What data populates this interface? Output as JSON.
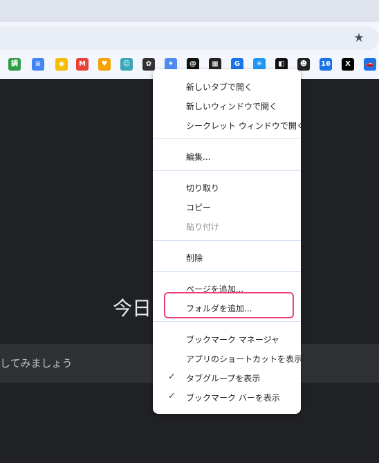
{
  "background": {
    "today_text": "今日",
    "search_text": "してみましょう"
  },
  "toolbar": {
    "star_icon": "bookmark-star-icon"
  },
  "bookmarks": {
    "icons": [
      {
        "name": "chosei-icon",
        "glyph": "調",
        "color": "#2e9e44"
      },
      {
        "name": "google-docs-icon",
        "glyph": "≡",
        "color": "#4285f4"
      },
      {
        "name": "google-keep-icon",
        "glyph": "◉",
        "color": "#f9bb00"
      },
      {
        "name": "gmail-icon",
        "glyph": "M",
        "color": "#ea4335"
      },
      {
        "name": "heart-app-icon",
        "glyph": "♥",
        "color": "#f4a300"
      },
      {
        "name": "avatar-icon",
        "glyph": "☺",
        "color": "#3aa6b9"
      },
      {
        "name": "chatgpt-icon",
        "glyph": "✿",
        "color": "#333333"
      },
      {
        "name": "gemini-icon",
        "glyph": "✦",
        "color": "#4f8bf5"
      },
      {
        "name": "threads-icon",
        "glyph": "@",
        "color": "#111111"
      },
      {
        "name": "app-grid-icon",
        "glyph": "▦",
        "color": "#222222"
      },
      {
        "name": "grammarly-icon",
        "glyph": "G",
        "color": "#1a73e8"
      },
      {
        "name": "perplexity-icon",
        "glyph": "✳",
        "color": "#2196f3"
      },
      {
        "name": "capcut-icon",
        "glyph": "◧",
        "color": "#111111"
      },
      {
        "name": "face-app-icon",
        "glyph": "☻",
        "color": "#222222"
      },
      {
        "name": "calendar-icon",
        "glyph": "16",
        "color": "#1a73e8"
      },
      {
        "name": "x-icon",
        "glyph": "X",
        "color": "#000000"
      },
      {
        "name": "car-app-icon",
        "glyph": "🚗",
        "color": "#1a73e8"
      }
    ]
  },
  "context_menu": {
    "open_new_tab": "新しいタブで開く",
    "open_new_window": "新しいウィンドウで開く",
    "open_incognito": "シークレット ウィンドウで開く",
    "edit": "編集...",
    "cut": "切り取り",
    "copy": "コピー",
    "paste": "貼り付け",
    "delete": "削除",
    "add_page": "ページを追加...",
    "add_folder": "フォルダを追加...",
    "bookmark_manager": "ブックマーク マネージャ",
    "show_apps_shortcut": "アプリのショートカットを表示",
    "show_tab_groups": "タブグループを表示",
    "show_bookmarks_bar": "ブックマーク バーを表示",
    "check_mark": "✓"
  }
}
